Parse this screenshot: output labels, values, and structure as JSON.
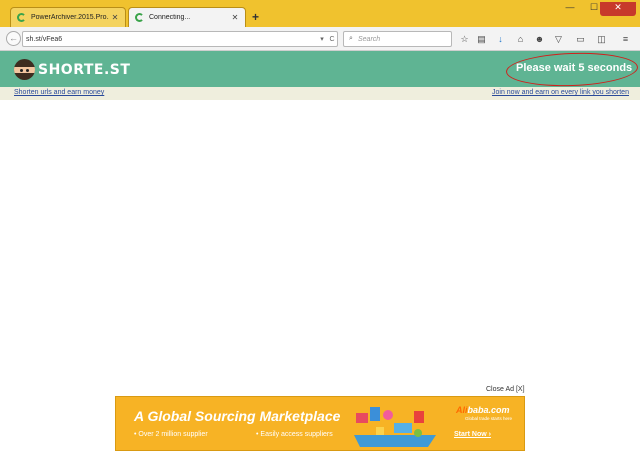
{
  "tabs": [
    {
      "label": "PowerArchiver.2015.Pro.15....",
      "state": "loading"
    },
    {
      "label": "Connecting...",
      "state": "loading",
      "active": true
    }
  ],
  "navbar": {
    "url": "sh.st/vFea6",
    "search_placeholder": "Search"
  },
  "site": {
    "logo_text": "SHORTE.ST",
    "wait_message": "Please wait 5 seconds",
    "left_link": "Shorten urls and earn money",
    "right_link": "Join now and earn on every link you shorten"
  },
  "ad": {
    "close_label": "Close Ad [X]",
    "headline": "A Global Sourcing Marketplace",
    "bullet1": "• Over 2 million supplier",
    "bullet2": "• Easily access suppliers",
    "brand_prefix": "Ali",
    "brand_rest": "baba.com",
    "brand_sub": "Global trade starts here",
    "cta": "Start Now ›"
  },
  "colors": {
    "titlebar": "#f0c22e",
    "site_header": "#5fb493",
    "ad_background": "#f7b325",
    "highlight_circle": "#d0201c"
  }
}
